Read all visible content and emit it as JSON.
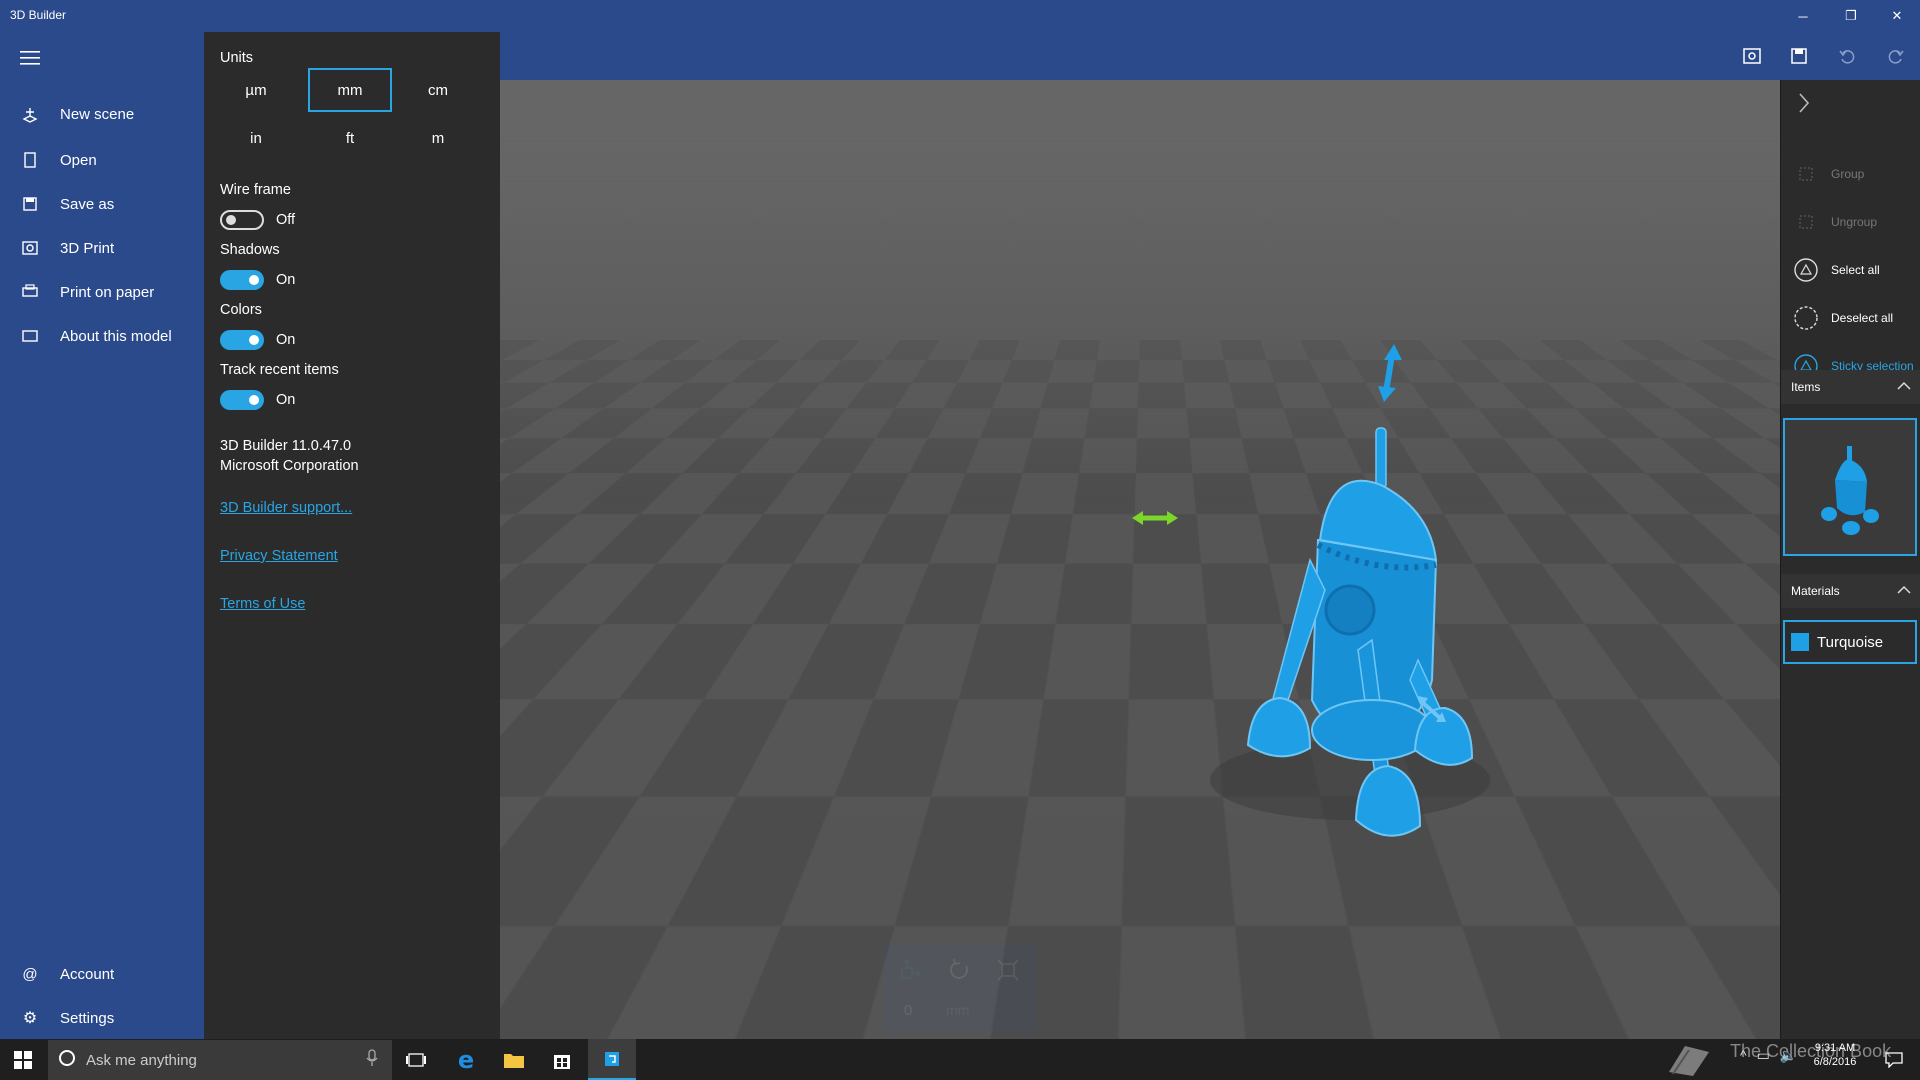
{
  "window": {
    "title": "3D Builder",
    "minimize": "─",
    "restore": "❐",
    "close": "✕"
  },
  "nav": {
    "items": [
      {
        "label": "New scene",
        "icon": "new-scene-icon"
      },
      {
        "label": "Open",
        "icon": "open-icon"
      },
      {
        "label": "Save as",
        "icon": "save-icon"
      },
      {
        "label": "3D Print",
        "icon": "print3d-icon"
      },
      {
        "label": "Print on paper",
        "icon": "print-paper-icon"
      },
      {
        "label": "About this model",
        "icon": "about-icon"
      }
    ],
    "account": "Account",
    "settings": "Settings"
  },
  "settings": {
    "units_label": "Units",
    "units": [
      "µm",
      "mm",
      "cm",
      "in",
      "ft",
      "m"
    ],
    "units_selected": "mm",
    "wireframe_label": "Wire frame",
    "wireframe_state": "Off",
    "shadows_label": "Shadows",
    "shadows_state": "On",
    "colors_label": "Colors",
    "colors_state": "On",
    "track_label": "Track recent items",
    "track_state": "On",
    "version": "3D Builder 11.0.47.0",
    "company": "Microsoft Corporation",
    "support_link": "3D Builder support...",
    "privacy_link": "Privacy Statement",
    "terms_link": "Terms of Use"
  },
  "right_panel": {
    "group": "Group",
    "ungroup": "Ungroup",
    "select_all": "Select all",
    "deselect_all": "Deselect all",
    "sticky": "Sticky selection",
    "items_header": "Items",
    "materials_header": "Materials",
    "material_name": "Turquoise"
  },
  "bottom_tool": {
    "value": "0",
    "unit": "mm"
  },
  "taskbar": {
    "search_placeholder": "Ask me anything",
    "time": "9:31 AM",
    "date": "6/8/2016",
    "watermark": "The Collection Book"
  },
  "colors": {
    "accent": "#29a5e4",
    "model": "#1e9fe6",
    "appbar": "#2b4a8b"
  }
}
